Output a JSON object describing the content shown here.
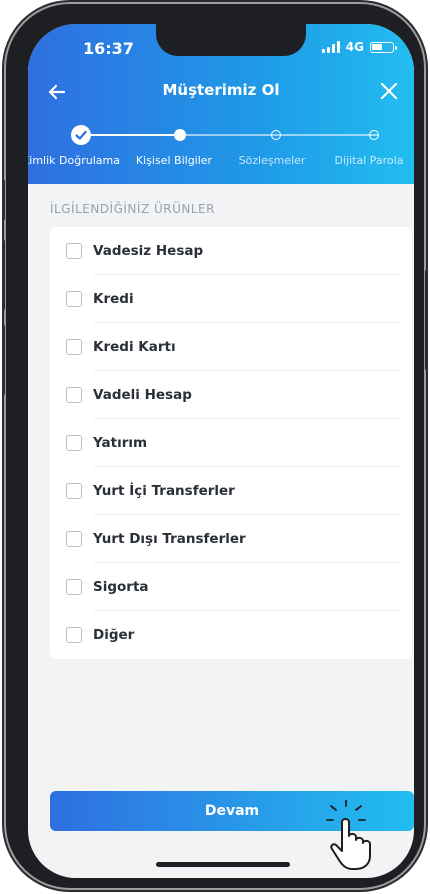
{
  "status_bar": {
    "time": "16:37",
    "network": "4G"
  },
  "header": {
    "title": "Müşterimiz Ol"
  },
  "stepper": {
    "steps": [
      {
        "label": "Kimlik Doğrulama",
        "state": "completed"
      },
      {
        "label": "Kişisel Bilgiler",
        "state": "current"
      },
      {
        "label": "Sözleşmeler",
        "state": "upcoming"
      },
      {
        "label": "Dijital Parola",
        "state": "upcoming"
      }
    ]
  },
  "section": {
    "title": "İLGİLENDİĞİNİZ ÜRÜNLER"
  },
  "products": [
    {
      "label": "Vadesiz Hesap",
      "checked": false
    },
    {
      "label": "Kredi",
      "checked": false
    },
    {
      "label": "Kredi Kartı",
      "checked": false
    },
    {
      "label": "Vadeli Hesap",
      "checked": false
    },
    {
      "label": "Yatırım",
      "checked": false
    },
    {
      "label": "Yurt İçi Transferler",
      "checked": false
    },
    {
      "label": "Yurt Dışı Transferler",
      "checked": false
    },
    {
      "label": "Sigorta",
      "checked": false
    },
    {
      "label": "Diğer",
      "checked": false
    }
  ],
  "footer": {
    "continue_label": "Devam"
  },
  "colors": {
    "gradient_start": "#2f6fe0",
    "gradient_end": "#22bdf0",
    "background": "#f1f3f5"
  },
  "icons": [
    "back-arrow-icon",
    "close-icon",
    "checkmark-icon",
    "signal-icon",
    "battery-icon",
    "tap-hand-icon"
  ]
}
